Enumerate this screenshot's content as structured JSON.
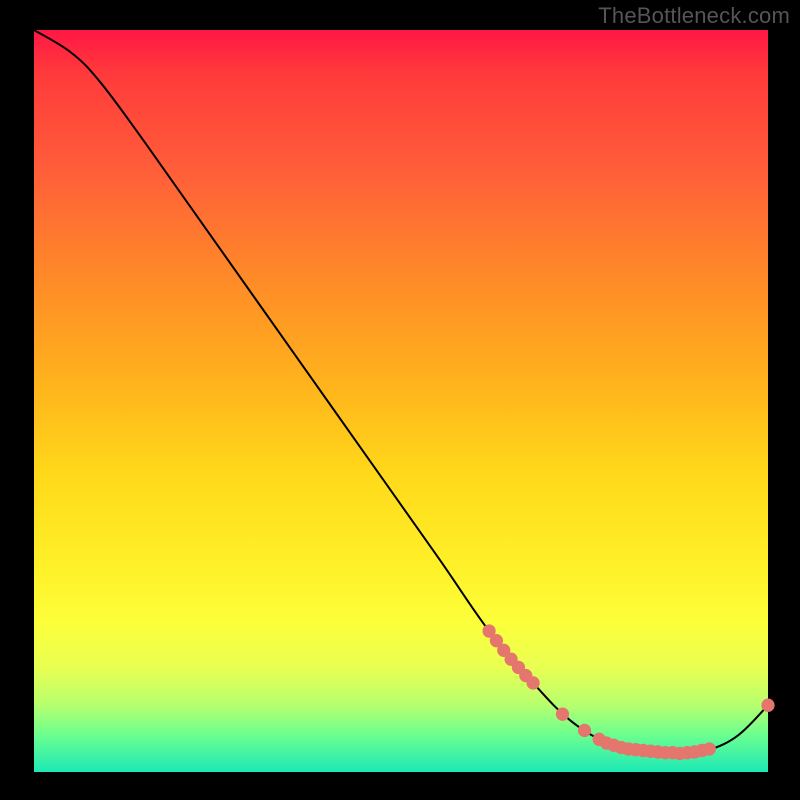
{
  "watermark": "TheBottleneck.com",
  "chart_data": {
    "type": "line",
    "title": "",
    "xlabel": "",
    "ylabel": "",
    "xlim": [
      0,
      100
    ],
    "ylim": [
      0,
      100
    ],
    "curve": [
      {
        "x": 0,
        "y": 100
      },
      {
        "x": 5,
        "y": 97
      },
      {
        "x": 9,
        "y": 93
      },
      {
        "x": 15,
        "y": 85
      },
      {
        "x": 25,
        "y": 71
      },
      {
        "x": 35,
        "y": 57
      },
      {
        "x": 45,
        "y": 43
      },
      {
        "x": 55,
        "y": 29
      },
      {
        "x": 62,
        "y": 19
      },
      {
        "x": 68,
        "y": 12
      },
      {
        "x": 73,
        "y": 7
      },
      {
        "x": 78,
        "y": 4
      },
      {
        "x": 83,
        "y": 2.8
      },
      {
        "x": 88,
        "y": 2.5
      },
      {
        "x": 92,
        "y": 3
      },
      {
        "x": 96,
        "y": 5
      },
      {
        "x": 100,
        "y": 9
      }
    ],
    "markers": [
      {
        "x": 62,
        "y": 19
      },
      {
        "x": 63,
        "y": 17.7
      },
      {
        "x": 64,
        "y": 16.4
      },
      {
        "x": 65,
        "y": 15.2
      },
      {
        "x": 66,
        "y": 14.1
      },
      {
        "x": 67,
        "y": 13
      },
      {
        "x": 68,
        "y": 12
      },
      {
        "x": 72,
        "y": 7.8
      },
      {
        "x": 75,
        "y": 5.6
      },
      {
        "x": 77,
        "y": 4.4
      },
      {
        "x": 78,
        "y": 3.9
      },
      {
        "x": 79,
        "y": 3.6
      },
      {
        "x": 80,
        "y": 3.3
      },
      {
        "x": 81,
        "y": 3.1
      },
      {
        "x": 82,
        "y": 3.0
      },
      {
        "x": 83,
        "y": 2.9
      },
      {
        "x": 84,
        "y": 2.8
      },
      {
        "x": 85,
        "y": 2.7
      },
      {
        "x": 86,
        "y": 2.6
      },
      {
        "x": 87,
        "y": 2.6
      },
      {
        "x": 88,
        "y": 2.5
      },
      {
        "x": 89,
        "y": 2.6
      },
      {
        "x": 90,
        "y": 2.7
      },
      {
        "x": 91,
        "y": 2.9
      },
      {
        "x": 92,
        "y": 3.1
      },
      {
        "x": 100,
        "y": 9
      }
    ],
    "marker_color": "#e4766d",
    "line_color": "#000000",
    "line_width": 2
  }
}
